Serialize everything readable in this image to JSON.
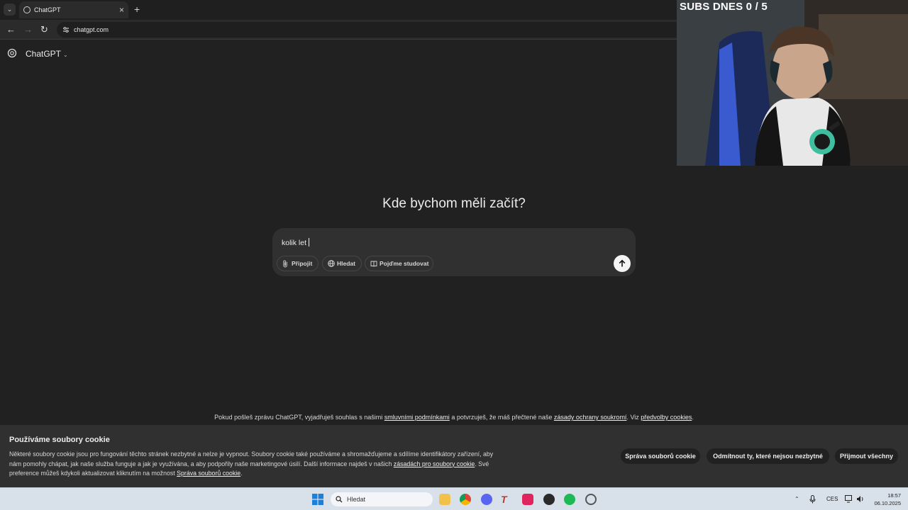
{
  "browser": {
    "tab_title": "ChatGPT",
    "url": "chatgpt.com"
  },
  "app": {
    "name": "ChatGPT"
  },
  "main": {
    "heading": "Kde bychom měli začít?",
    "input_value": "kolik let",
    "buttons": {
      "attach": "Připojit",
      "search": "Hledat",
      "study": "Pojďme studovat"
    }
  },
  "terms": {
    "prefix": "Pokud pošleš zprávu ChatGPT, vyjadřuješ souhlas s našimi ",
    "terms_link": "smluvními podmínkami",
    "middle": " a potvrzuješ, že máš přečtené naše ",
    "privacy_link": "zásady ochrany soukromí",
    "between": ". Viz ",
    "cookies_link": "předvolby cookies",
    "suffix": "."
  },
  "cookie_banner": {
    "title": "Používáme soubory cookie",
    "text": "Některé soubory cookie jsou pro fungování těchto stránek nezbytné a nelze je vypnout. Soubory cookie také používáme a shromažďujeme a sdílíme identifikátory zařízení, aby nám pomohly chápat, jak naše služba funguje a jak je využívána, a aby podpořily naše marketingové úsilí. Další informace najdeš v našich ",
    "policy_link": "zásadách pro soubory cookie",
    "text2": ". Své preference můžeš kdykoli aktualizovat kliknutím na možnost ",
    "manage_link": "Správa souborů cookie",
    "text3": ".",
    "btn_manage": "Správa souborů cookie",
    "btn_reject": "Odmítnout ty, které nejsou nezbytné",
    "btn_accept": "Přijmout všechny"
  },
  "webcam": {
    "overlay_text": "SUBS DNES  0 / 5"
  },
  "taskbar": {
    "search_placeholder": "Hledat",
    "language": "CES",
    "time": "18:57",
    "date": "06.10.2025",
    "icons": [
      "windows-start-icon",
      "file-explorer-icon",
      "chrome-icon",
      "discord-icon",
      "typora-icon",
      "tiktok-icon",
      "obs-icon",
      "spotify-icon",
      "settings-icon"
    ]
  },
  "colors": {
    "page_bg": "#212121",
    "composer_bg": "#303030",
    "cookie_bg": "#303030",
    "taskbar_bg": "#d8e0ea"
  }
}
